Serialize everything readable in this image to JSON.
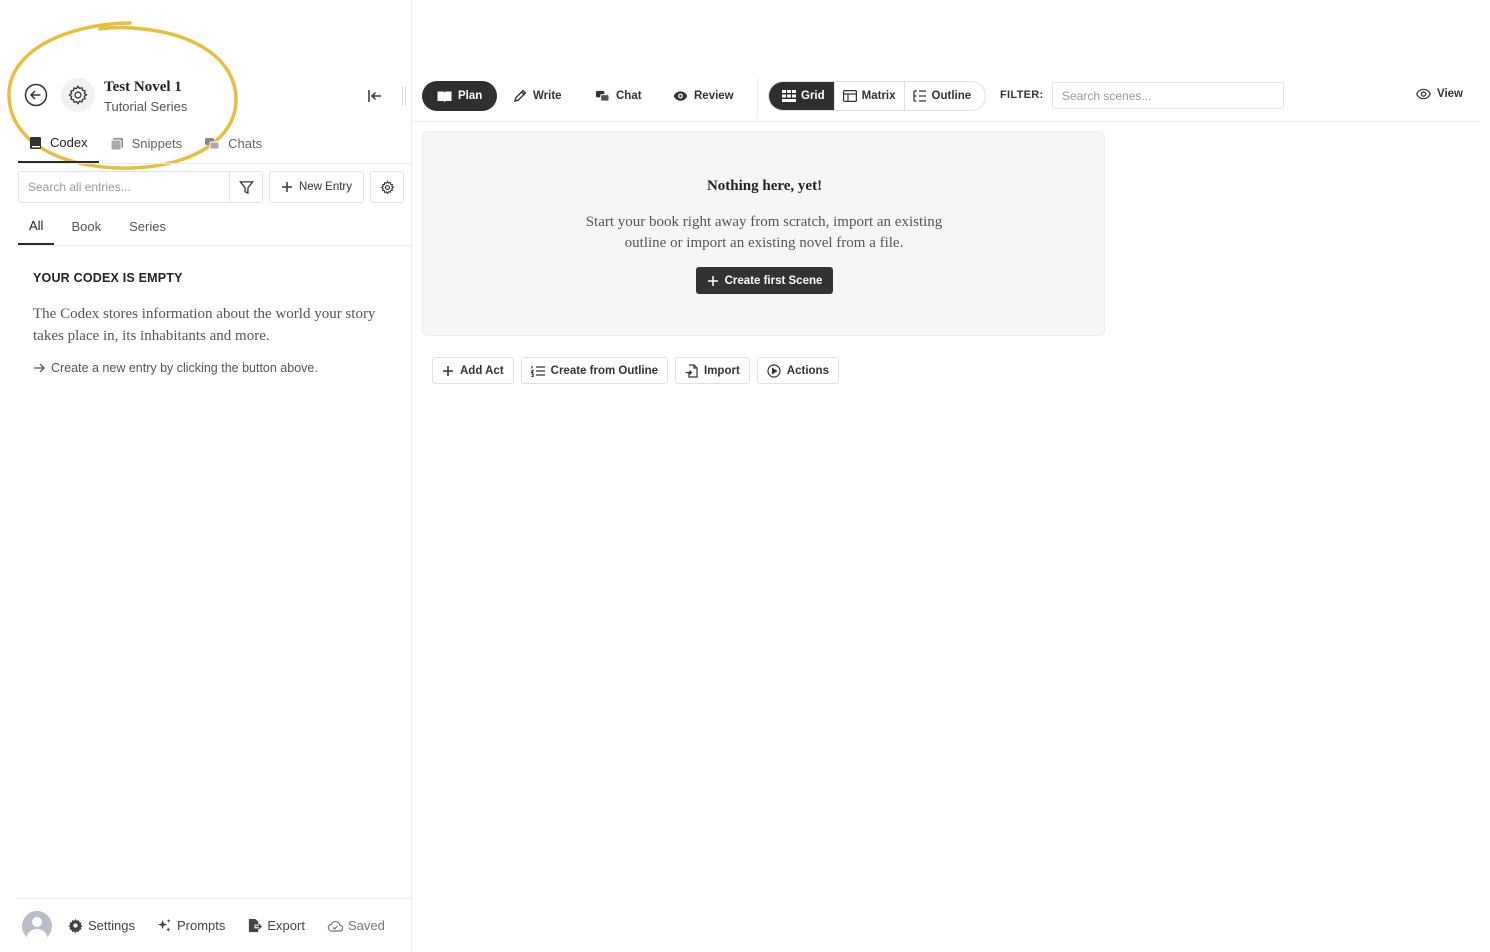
{
  "project": {
    "title": "Test Novel 1",
    "series": "Tutorial Series"
  },
  "sidebar": {
    "tabs": [
      {
        "label": "Codex",
        "icon": "book-icon",
        "active": true
      },
      {
        "label": "Snippets",
        "icon": "snippets-icon",
        "active": false
      },
      {
        "label": "Chats",
        "icon": "chat-bubbles-icon",
        "active": false
      }
    ],
    "search": {
      "placeholder": "Search all entries..."
    },
    "new_entry_label": "New Entry",
    "subtabs": [
      {
        "label": "All",
        "active": true
      },
      {
        "label": "Book",
        "active": false
      },
      {
        "label": "Series",
        "active": false
      }
    ],
    "empty": {
      "heading": "YOUR CODEX IS EMPTY",
      "description": "The Codex stores information about the world your story takes place in, its inhabitants and more.",
      "hint": "Create a new entry by clicking the button above."
    },
    "bottom": {
      "settings_label": "Settings",
      "prompts_label": "Prompts",
      "export_label": "Export",
      "saved_label": "Saved"
    }
  },
  "topbar": {
    "modes": [
      {
        "label": "Plan",
        "icon": "book-open-icon",
        "active": true
      },
      {
        "label": "Write",
        "icon": "pencil-icon",
        "active": false
      },
      {
        "label": "Chat",
        "icon": "chat-bubbles-icon",
        "active": false
      },
      {
        "label": "Review",
        "icon": "eye-icon",
        "active": false
      }
    ],
    "views": [
      {
        "label": "Grid",
        "icon": "grid-icon",
        "active": true
      },
      {
        "label": "Matrix",
        "icon": "matrix-icon",
        "active": false
      },
      {
        "label": "Outline",
        "icon": "outline-icon",
        "active": false
      }
    ],
    "filter_label": "FILTER:",
    "scene_search_placeholder": "Search scenes...",
    "view_label": "View"
  },
  "main": {
    "empty_title": "Nothing here, yet!",
    "empty_text": "Start your book right away from scratch, import an existing outline or import an existing novel from a file.",
    "create_scene_label": "Create first Scene",
    "actions": {
      "add_act": "Add Act",
      "create_from_outline": "Create from Outline",
      "import": "Import",
      "actions": "Actions"
    }
  },
  "colors": {
    "accent_dark": "#2f2f2f",
    "annotation_circle": "#e7bf3e"
  }
}
